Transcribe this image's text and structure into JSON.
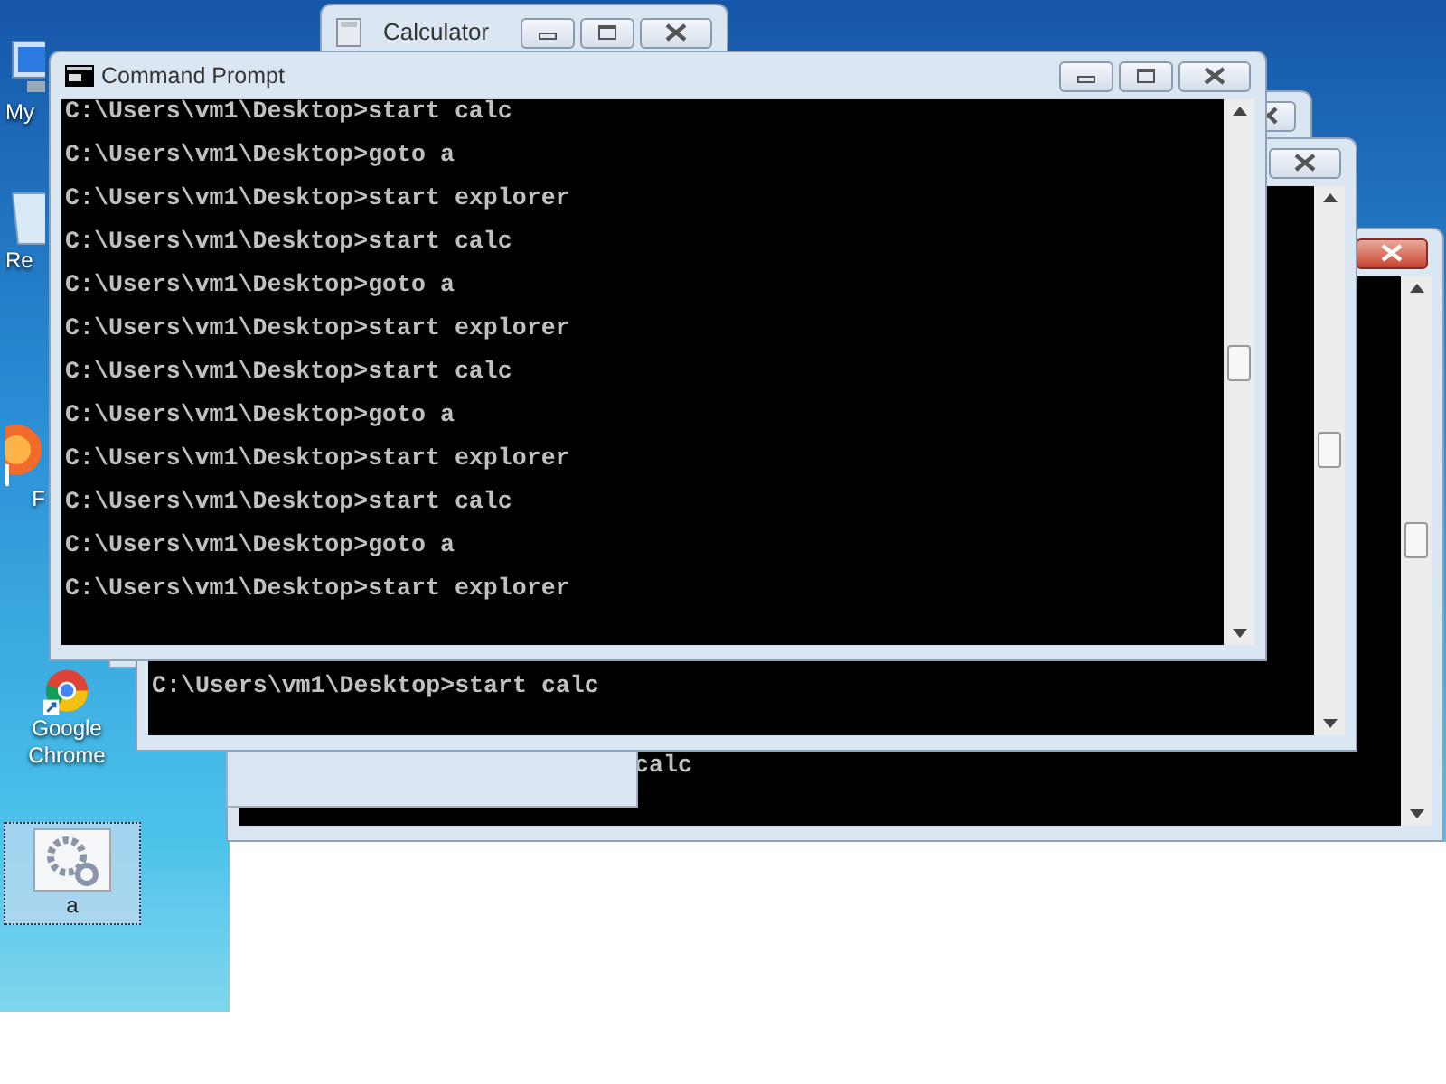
{
  "desktop": {
    "icons": [
      {
        "kind": "computer",
        "label": "My",
        "selected": false
      },
      {
        "kind": "recycle",
        "label": "Re",
        "selected": false
      },
      {
        "kind": "browser",
        "label": "F",
        "selected": false
      },
      {
        "kind": "chrome",
        "label": "Google Chrome",
        "selected": false
      },
      {
        "kind": "batch",
        "label": "a",
        "selected": true
      }
    ]
  },
  "windows": [
    {
      "kind": "console",
      "close_highlighted": true,
      "lines": [
        "calc"
      ]
    },
    {
      "kind": "blank"
    },
    {
      "kind": "console",
      "close_highlighted": false
    },
    {
      "kind": "console",
      "close_highlighted": false,
      "lines": [
        "C:\\Users\\vm1\\Desktop>start calc"
      ]
    },
    {
      "kind": "calculator",
      "title": "Calculator",
      "close_highlighted": false
    },
    {
      "kind": "console",
      "title": "Command Prompt",
      "close_highlighted": false,
      "lines": [
        "C:\\Users\\vm1\\Desktop>start calc",
        "C:\\Users\\vm1\\Desktop>goto a",
        "C:\\Users\\vm1\\Desktop>start explorer",
        "C:\\Users\\vm1\\Desktop>start calc",
        "C:\\Users\\vm1\\Desktop>goto a",
        "C:\\Users\\vm1\\Desktop>start explorer",
        "C:\\Users\\vm1\\Desktop>start calc",
        "C:\\Users\\vm1\\Desktop>goto a",
        "C:\\Users\\vm1\\Desktop>start explorer",
        "C:\\Users\\vm1\\Desktop>start calc",
        "C:\\Users\\vm1\\Desktop>goto a",
        "C:\\Users\\vm1\\Desktop>start explorer"
      ]
    }
  ]
}
